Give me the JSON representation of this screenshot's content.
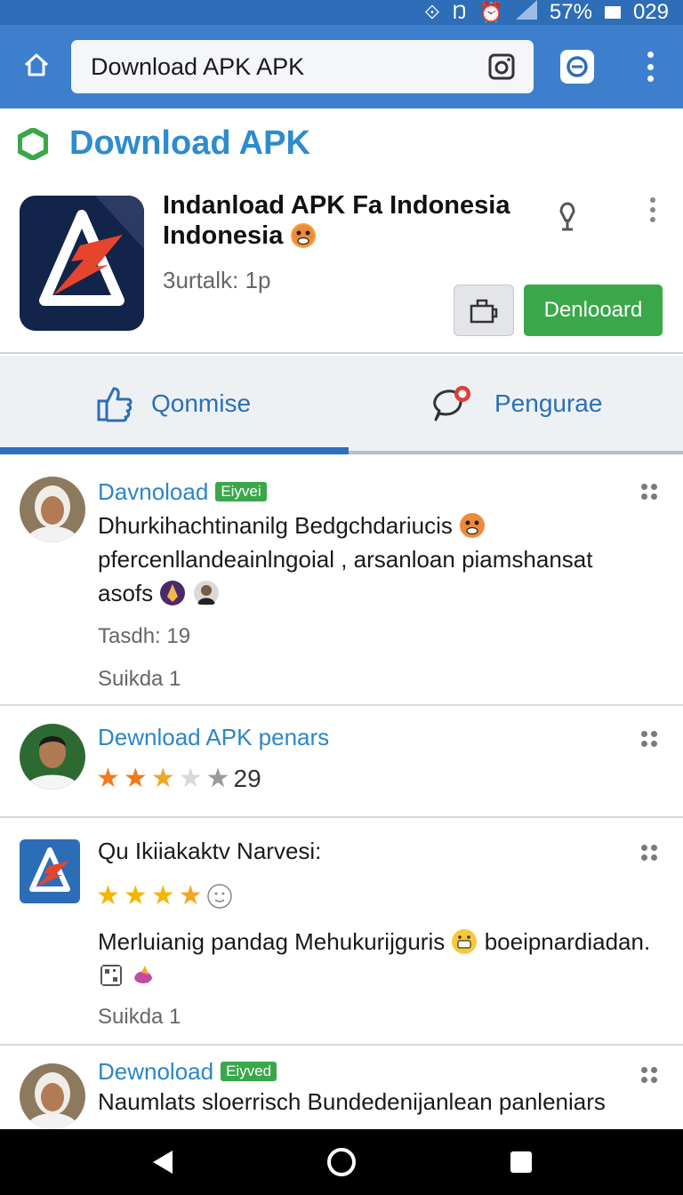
{
  "status_bar": {
    "battery": "57%",
    "time": "029",
    "icons": [
      "network-icon",
      "nfc-icon",
      "alarm-icon",
      "signal-icon",
      "battery-icon"
    ]
  },
  "browser": {
    "url": "Download APK APK",
    "icons": [
      "home-icon",
      "camera-icon",
      "sync-icon",
      "more-vert-icon"
    ]
  },
  "site": {
    "title": "Download APK",
    "logo_color": "#3aa84a",
    "accent": "#2d8bd0"
  },
  "app": {
    "name": "Indanload APK Fa Indonesia Indonesia",
    "meta": "3urtalk: 1p",
    "download_label": "Denlooard",
    "icons": [
      "mic-icon",
      "more-vert-icon",
      "bag-icon"
    ],
    "download_color": "#3aa84a"
  },
  "tabs": [
    {
      "label": "Qonmise",
      "icon": "thumbs-up-icon",
      "active": true
    },
    {
      "label": "Pengurae",
      "icon": "chat-bubble-icon",
      "active": false
    }
  ],
  "reviews": [
    {
      "name": "Davnoload",
      "badge": "Eiyvei",
      "text": "Dhurkihachtinanilg Bedgchdariucis",
      "text2": "pfercenllandeainlngoial , arsanloan piamshansat",
      "text3": "asofs",
      "meta1": "Tasdh: 19",
      "meta2": "Suikda   1"
    },
    {
      "name": "Dewnload APK  penars",
      "rating": 2.5,
      "rating_count": "29"
    },
    {
      "name": "Qu Ikiiakaktv Narvesi:",
      "rating": 3.5,
      "text": "Merluianig pandag Mehukurijguris",
      "text_tail": "boeipnardiadan.",
      "meta2": "Suikda   1"
    },
    {
      "name": "Dewnoload",
      "badge": "Eiyved",
      "text": "Naumlats sloerrisch Bundedenijanlean panleniars"
    }
  ],
  "nav": {
    "icons": [
      "back-icon",
      "home-circle-icon",
      "recents-icon"
    ]
  }
}
